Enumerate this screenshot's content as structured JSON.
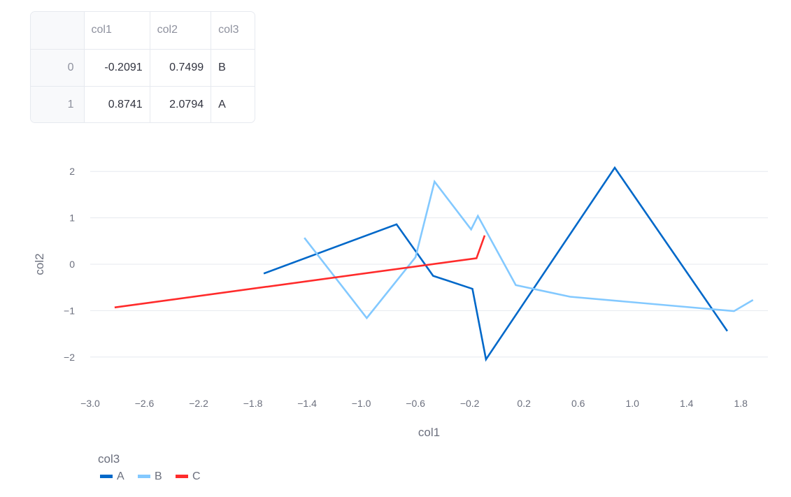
{
  "dataframe": {
    "columns": [
      "col1",
      "col2",
      "col3"
    ],
    "rows": [
      {
        "index": "0",
        "cells": [
          "-0.2091",
          "0.7499",
          "B"
        ]
      },
      {
        "index": "1",
        "cells": [
          "0.8741",
          "2.0794",
          "A"
        ]
      }
    ]
  },
  "chart_data": {
    "type": "line",
    "xlabel": "col1",
    "ylabel": "col2",
    "xlim": [
      -3.0,
      2.0
    ],
    "ylim": [
      -2.5,
      2.5
    ],
    "x_ticks": [
      -3.0,
      -2.6,
      -2.2,
      -1.8,
      -1.4,
      -1.0,
      -0.6,
      -0.2,
      0.2,
      0.6,
      1.0,
      1.4,
      1.8
    ],
    "y_ticks": [
      -2,
      -1,
      0,
      1,
      2
    ],
    "grid": true,
    "legend": {
      "title": "col3",
      "placement": "bottom-left"
    },
    "series": [
      {
        "name": "A",
        "color": "#0068c9",
        "x": [
          -1.72,
          -0.74,
          -0.47,
          -0.18,
          -0.08,
          0.87,
          1.7
        ],
        "y": [
          -0.2,
          0.86,
          -0.25,
          -0.53,
          -2.05,
          2.08,
          -1.44
        ]
      },
      {
        "name": "B",
        "color": "#83c9ff",
        "x": [
          -1.42,
          -0.96,
          -0.6,
          -0.46,
          -0.19,
          -0.14,
          0.14,
          0.54,
          1.75,
          1.89
        ],
        "y": [
          0.57,
          -1.16,
          0.15,
          1.78,
          0.75,
          1.04,
          -0.45,
          -0.7,
          -1.01,
          -0.77
        ]
      },
      {
        "name": "C",
        "color": "#ff2b2b",
        "x": [
          -2.82,
          -0.15,
          -0.09
        ],
        "y": [
          -0.93,
          0.13,
          0.62
        ]
      }
    ]
  }
}
